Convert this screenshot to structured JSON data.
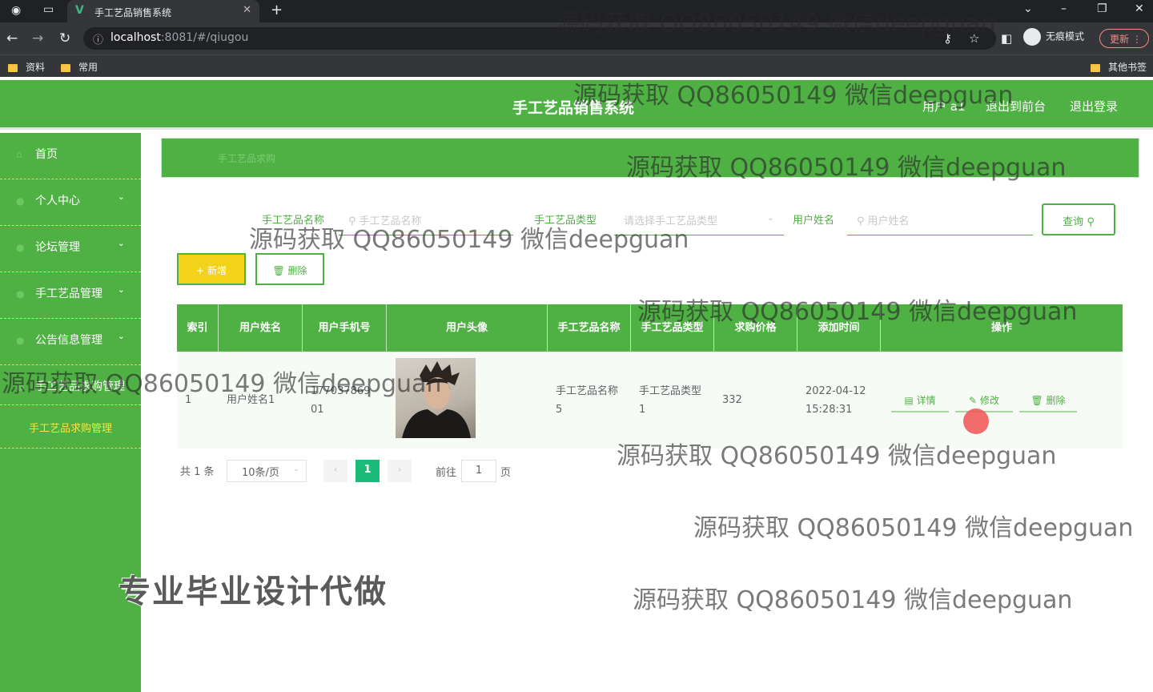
{
  "browser": {
    "tab_title": "手工艺品销售系统",
    "url_host": "localhost",
    "url_path": ":8081/#/qiugou",
    "incognito_label": "无痕模式",
    "update_label": "更新",
    "bookmarks": [
      "资料",
      "常用"
    ],
    "other_bookmarks": "其他书签"
  },
  "header": {
    "title": "手工艺品销售系统",
    "user": "用户 a1",
    "back_to_front": "退出到前台",
    "logout": "退出登录"
  },
  "sidebar": {
    "items": [
      {
        "label": "首页",
        "has_arrow": false
      },
      {
        "label": "个人中心",
        "has_arrow": true
      },
      {
        "label": "论坛管理",
        "has_arrow": true
      },
      {
        "label": "手工艺品管理",
        "has_arrow": true
      },
      {
        "label": "公告信息管理",
        "has_arrow": true
      },
      {
        "label": "手工艺品求购管理",
        "has_arrow": true
      }
    ],
    "active_sub": "手工艺品求购管理"
  },
  "breadcrumb": "手工艺品求购",
  "search": {
    "field1_label": "手工艺品名称",
    "field1_placeholder": "手工艺品名称",
    "field2_label": "手工艺品类型",
    "field2_placeholder": "请选择手工艺品类型",
    "field3_label": "用户姓名",
    "field3_placeholder": "用户姓名",
    "button": "查询"
  },
  "actions": {
    "add": "新增",
    "delete": "删除"
  },
  "table": {
    "headers": [
      "索引",
      "用户姓名",
      "用户手机号",
      "用户头像",
      "手工艺品名称",
      "手工艺品类型",
      "求购价格",
      "添加时间",
      "操作"
    ],
    "rows": [
      {
        "index": "1",
        "username": "用户姓名1",
        "phone": "17703786901",
        "product_name": "手工艺品名称5",
        "product_type": "手工艺品类型1",
        "price": "332",
        "date": "2022-04-12",
        "time": "15:28:31",
        "ops": {
          "detail": "详情",
          "edit": "修改",
          "delete": "删除"
        }
      }
    ]
  },
  "pagination": {
    "total": "共 1 条",
    "page_size": "10条/页",
    "current_page": "1",
    "goto_label": "前往",
    "goto_value": "1",
    "page_suffix": "页"
  },
  "watermark": "源码获取 QQ86050149 微信deepguan",
  "promo": "专业毕业设计代做",
  "colors": {
    "primary": "#4fb144",
    "accent_yellow": "#f3d21a",
    "page_active": "#1bbc7a"
  }
}
